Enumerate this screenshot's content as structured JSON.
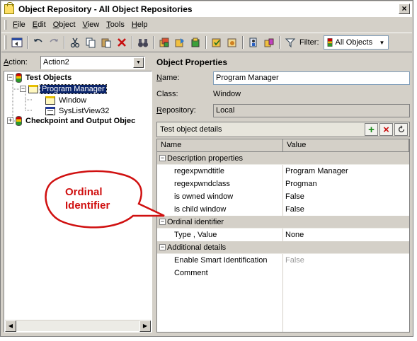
{
  "window": {
    "title": "Object Repository - All Object Repositories",
    "close_glyph": "×"
  },
  "menu": [
    "File",
    "Edit",
    "Object",
    "View",
    "Tools",
    "Help"
  ],
  "toolbar": {
    "filter_label": "Filter:",
    "filter_value": "All Objects"
  },
  "action": {
    "label": "Action:",
    "value": "Action2"
  },
  "tree": {
    "items": [
      {
        "label": "Test Objects",
        "bold": true
      },
      {
        "label": "Program Manager",
        "selected": true
      },
      {
        "label": "Window"
      },
      {
        "label": "SysListView32"
      },
      {
        "label": "Checkpoint and Output Objec",
        "bold": true
      }
    ]
  },
  "properties": {
    "title": "Object Properties",
    "name_label": "Name:",
    "name_value": "Program Manager",
    "class_label": "Class:",
    "class_value": "Window",
    "repository_label": "Repository:",
    "repository_value": "Local"
  },
  "details": {
    "title": "Test object details",
    "add_glyph": "+",
    "remove_glyph": "×",
    "col_name": "Name",
    "col_value": "Value",
    "description_category": "Description properties",
    "rows_description": [
      {
        "name": "regexpwndtitle",
        "value": "Program Manager"
      },
      {
        "name": "regexpwndclass",
        "value": "Progman"
      },
      {
        "name": "is owned window",
        "value": "False"
      },
      {
        "name": "is child window",
        "value": "False"
      }
    ],
    "ordinal_category": "Ordinal identifier",
    "rows_ordinal": [
      {
        "name": "Type , Value",
        "value": "None"
      }
    ],
    "additional_category": "Additional details",
    "rows_additional": [
      {
        "name": "Enable Smart Identification",
        "value": "False"
      },
      {
        "name": "Comment",
        "value": ""
      }
    ]
  },
  "annotation": {
    "line1": "Ordinal",
    "line2": "Identifier",
    "color": "#d01010"
  }
}
